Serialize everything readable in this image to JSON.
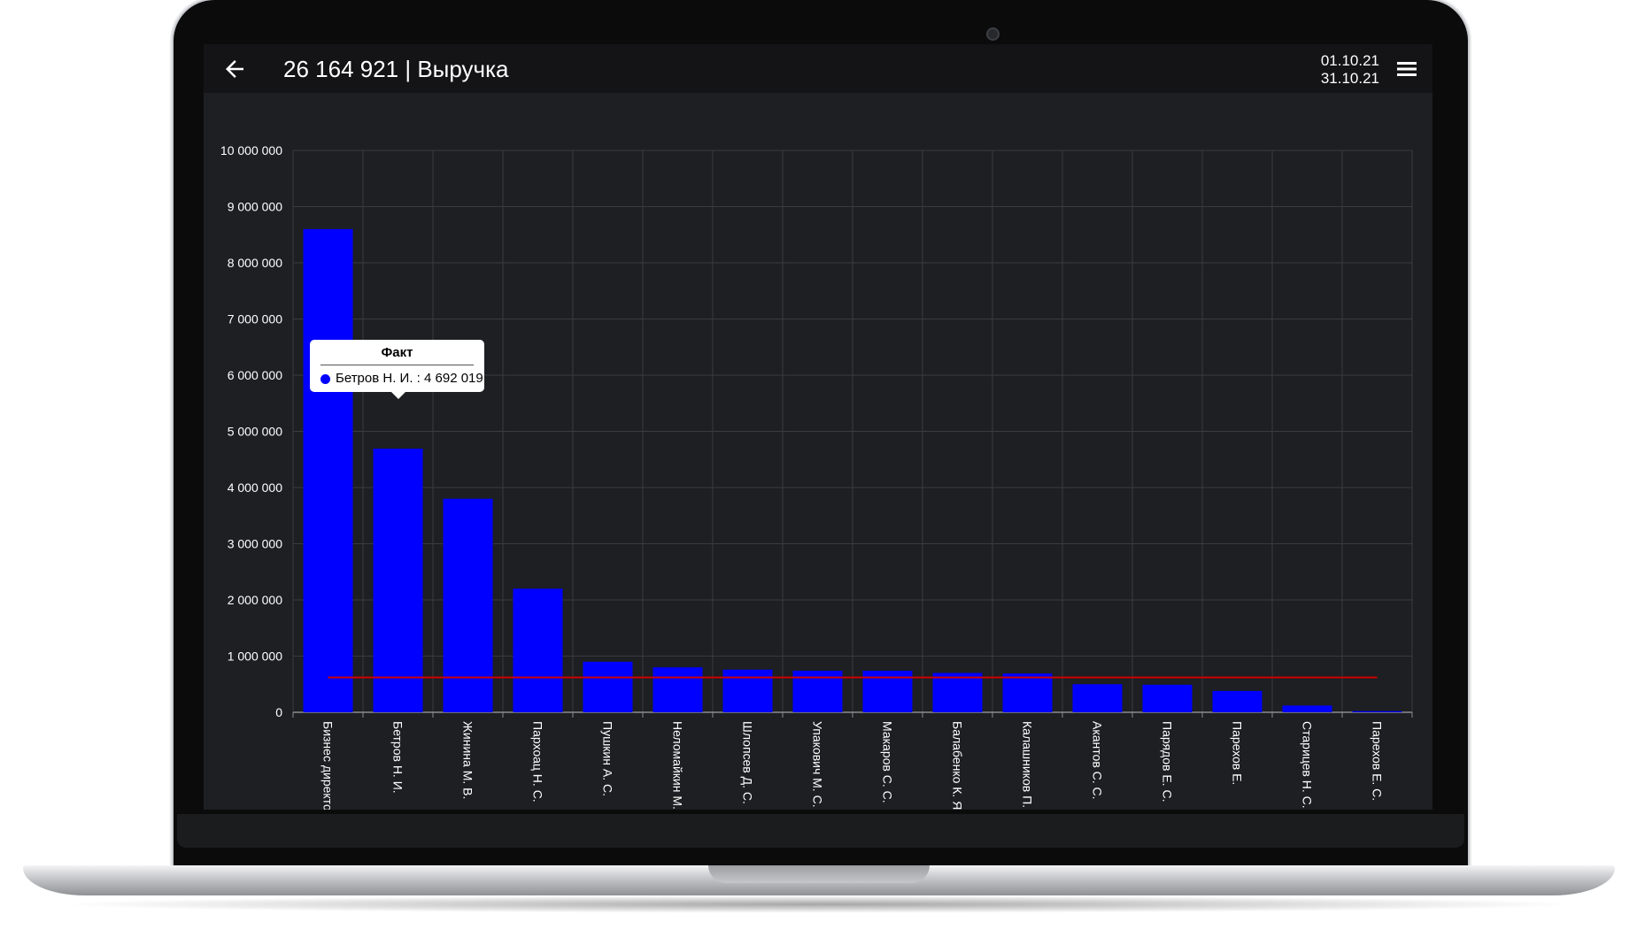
{
  "header": {
    "title": "26 164 921 | Выручка",
    "date_from": "01.10.21",
    "date_to": "31.10.21",
    "back_icon": "arrow-left-icon",
    "menu_icon": "hamburger-menu-icon"
  },
  "colors": {
    "bar": "#0000ff",
    "average_line": "#cc0000",
    "background": "#1e1f23",
    "grid": "#3a3b40"
  },
  "tooltip": {
    "title": "Факт",
    "text": "Бетров Н. И. : 4 692 019"
  },
  "chart_data": {
    "type": "bar",
    "categories": [
      "Бизнес директор Б.",
      "Бетров Н. И.",
      "Жинина М. В.",
      "Пархоац Н. С.",
      "Пушкин А. С.",
      "Неломайкин М. С.",
      "Шлопсев Д. С.",
      "Упакович М. С.",
      "Макаров С. С.",
      "Балабенко К. Я.",
      "Калашников П. С.",
      "Акантов С. С.",
      "Парядов Е. С.",
      "Парехов Е.",
      "Старицев Н. С.",
      "Парехов Е. С."
    ],
    "values": [
      8600000,
      4692019,
      3800000,
      2200000,
      900000,
      800000,
      760000,
      740000,
      740000,
      700000,
      690000,
      500000,
      490000,
      380000,
      120000,
      20000
    ],
    "average_line_value": 620000,
    "ylim": [
      0,
      10000000
    ],
    "y_ticks": [
      "0",
      "1 000 000",
      "2 000 000",
      "3 000 000",
      "4 000 000",
      "5 000 000",
      "6 000 000",
      "7 000 000",
      "8 000 000",
      "9 000 000",
      "10 000 000"
    ],
    "grid": true
  }
}
